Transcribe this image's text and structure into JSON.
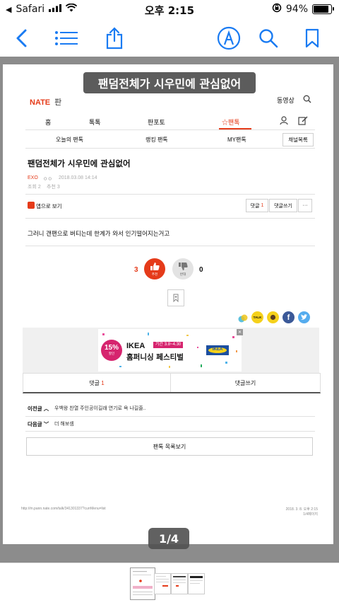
{
  "status": {
    "carrier": "Safari",
    "time": "오후 2:15",
    "battery": "94%",
    "battery_level": 0.94
  },
  "article": {
    "page_title": "팬덤전체가 시우민에 관심없어",
    "brand": "NATE",
    "brand_sub": "판",
    "video_link": "동영상",
    "nav": [
      "홈",
      "톡톡",
      "판포토",
      "☆팬톡"
    ],
    "subnav": [
      "오늘의 팬톡",
      "랭킹 팬톡",
      "MY팬톡"
    ],
    "channel_list": "채널목록",
    "heading": "팬덤전체가 시우민에 관심없어",
    "category": "EXO",
    "author": "ㅇㅇ",
    "datetime": "2018.03.08 14:14",
    "views": "조회 2",
    "recommends": "추천 3",
    "app_view": "앱으로 보기",
    "comment_btn_label": "댓글",
    "comment_count": "1",
    "write_comment": "댓글쓰기",
    "more": "···",
    "body": "그러니 갠팬으로 버티는데 한계가 와서 인기떨어지는거고",
    "like_count": "3",
    "like_label": "추천",
    "dislike_count": "0",
    "dislike_label": "반대",
    "ad": {
      "badge": "15%",
      "badge_sub": "할인",
      "title": "IKEA",
      "period_label": "기간",
      "period": "3.8~4.30",
      "line": "홈퍼니싱 페스티벌"
    },
    "tab_comments": "댓글",
    "tab_write": "댓글쓰기",
    "prev_label": "이전글",
    "prev_text": "우백왕 찬열 주인공이길래 연기로 욕 나길줄..",
    "next_label": "다음글",
    "next_text": "더 해보셈",
    "list_button": "팬톡 목록보기",
    "footer_url": "http://m.pann.nate.com/talk/341301337?currMenu=list",
    "footer_date": "2018. 3. 8. 오후 2:15",
    "footer_page": "1/4페이지"
  },
  "viewer": {
    "page_indicator": "1/4",
    "title_overlay": "팬덤전체가 시우민에 관심없어"
  }
}
